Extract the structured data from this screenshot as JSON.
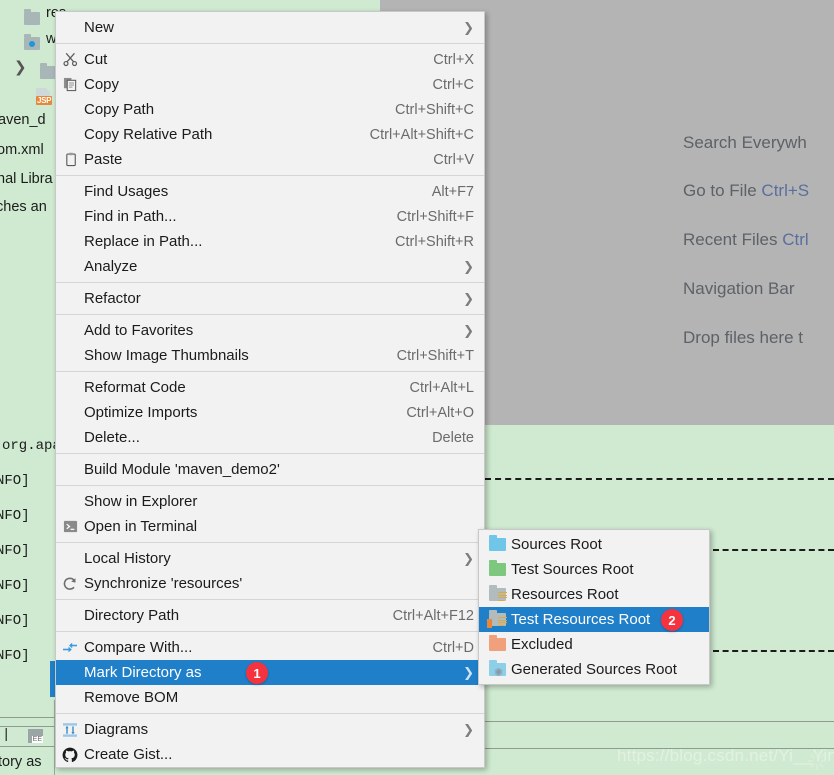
{
  "app": {
    "watermark": "https://blog.csdn.net/Yi__Ying"
  },
  "colors": {
    "menu_bg": "#f2f2f2",
    "selection_blue": "#1f7fc9",
    "badge_red": "#f5333f",
    "editor_gray": "#b4b4b4",
    "tree_green": "#cfead0"
  },
  "project_tree": {
    "items": [
      {
        "label": "res",
        "icon": "folder-icon"
      },
      {
        "label": "we",
        "icon": "folder-web-icon"
      },
      {
        "label": "",
        "icon": "folder-icon"
      },
      {
        "label": "JSP",
        "icon": "jsp-file-icon"
      },
      {
        "label": "aven_d",
        "icon": "none"
      },
      {
        "label": "om.xml",
        "icon": "none"
      },
      {
        "label": "nal Libra",
        "icon": "none"
      },
      {
        "label": "ches an",
        "icon": "none"
      }
    ]
  },
  "console": {
    "lines": [
      "org.apa",
      "NFO]",
      "NFO]",
      "NFO]",
      "NFO]",
      "NFO]",
      "NFO]"
    ]
  },
  "status_bar": {
    "label": "tory as"
  },
  "editor_hints": [
    {
      "text": "Search Everywh",
      "shortcut": ""
    },
    {
      "text": "Go to File ",
      "shortcut": "Ctrl+S"
    },
    {
      "text": "Recent Files ",
      "shortcut": "Ctrl"
    },
    {
      "text": "Navigation Bar ",
      "shortcut": ""
    },
    {
      "text": "Drop files here t",
      "shortcut": ""
    }
  ],
  "context_menu": {
    "groups": [
      {
        "items": [
          {
            "label": "New",
            "shortcut": "",
            "icon": "none",
            "submenu": true,
            "mnemonic": ""
          }
        ]
      },
      {
        "items": [
          {
            "label": "Cut",
            "shortcut": "Ctrl+X",
            "icon": "scissors-icon",
            "submenu": false,
            "mnemonic": "t"
          },
          {
            "label": "Copy",
            "shortcut": "Ctrl+C",
            "icon": "copy-icon",
            "submenu": false,
            "mnemonic": "C"
          },
          {
            "label": "Copy Path",
            "shortcut": "Ctrl+Shift+C",
            "icon": "none",
            "submenu": false,
            "mnemonic": "o"
          },
          {
            "label": "Copy Relative Path",
            "shortcut": "Ctrl+Alt+Shift+C",
            "icon": "none",
            "submenu": false,
            "mnemonic": "y"
          },
          {
            "label": "Paste",
            "shortcut": "Ctrl+V",
            "icon": "clipboard-icon",
            "submenu": false,
            "mnemonic": "P"
          }
        ]
      },
      {
        "items": [
          {
            "label": "Find Usages",
            "shortcut": "Alt+F7",
            "icon": "none",
            "submenu": false,
            "mnemonic": "U"
          },
          {
            "label": "Find in Path...",
            "shortcut": "Ctrl+Shift+F",
            "icon": "none",
            "submenu": false,
            "mnemonic": "P"
          },
          {
            "label": "Replace in Path...",
            "shortcut": "Ctrl+Shift+R",
            "icon": "none",
            "submenu": false,
            "mnemonic": "a"
          },
          {
            "label": "Analyze",
            "shortcut": "",
            "icon": "none",
            "submenu": true,
            "mnemonic": "z"
          }
        ]
      },
      {
        "items": [
          {
            "label": "Refactor",
            "shortcut": "",
            "icon": "none",
            "submenu": true,
            "mnemonic": "R"
          }
        ]
      },
      {
        "items": [
          {
            "label": "Add to Favorites",
            "shortcut": "",
            "icon": "none",
            "submenu": true,
            "mnemonic": "F"
          },
          {
            "label": "Show Image Thumbnails",
            "shortcut": "Ctrl+Shift+T",
            "icon": "none",
            "submenu": false,
            "mnemonic": ""
          }
        ]
      },
      {
        "items": [
          {
            "label": "Reformat Code",
            "shortcut": "Ctrl+Alt+L",
            "icon": "none",
            "submenu": false,
            "mnemonic": "R"
          },
          {
            "label": "Optimize Imports",
            "shortcut": "Ctrl+Alt+O",
            "icon": "none",
            "submenu": false,
            "mnemonic": "z"
          },
          {
            "label": "Delete...",
            "shortcut": "Delete",
            "icon": "none",
            "submenu": false,
            "mnemonic": "D"
          }
        ]
      },
      {
        "items": [
          {
            "label": "Build Module 'maven_demo2'",
            "shortcut": "",
            "icon": "none",
            "submenu": false,
            "mnemonic": "M"
          }
        ]
      },
      {
        "items": [
          {
            "label": "Show in Explorer",
            "shortcut": "",
            "icon": "none",
            "submenu": false,
            "mnemonic": ""
          },
          {
            "label": "Open in Terminal",
            "shortcut": "",
            "icon": "terminal-icon",
            "submenu": false,
            "mnemonic": "O"
          }
        ]
      },
      {
        "items": [
          {
            "label": "Local History",
            "shortcut": "",
            "icon": "none",
            "submenu": true,
            "mnemonic": "H"
          },
          {
            "label": "Synchronize 'resources'",
            "shortcut": "",
            "icon": "refresh-icon",
            "submenu": false,
            "mnemonic": ""
          }
        ]
      },
      {
        "items": [
          {
            "label": "Directory Path",
            "shortcut": "Ctrl+Alt+F12",
            "icon": "none",
            "submenu": false,
            "mnemonic": "P"
          }
        ]
      },
      {
        "items": [
          {
            "label": "Compare With...",
            "shortcut": "Ctrl+D",
            "icon": "compare-icon",
            "submenu": false,
            "mnemonic": ""
          },
          {
            "label": "Mark Directory as",
            "shortcut": "",
            "icon": "none",
            "submenu": true,
            "selected": true,
            "badge": "1",
            "mnemonic": ""
          },
          {
            "label": "Remove BOM",
            "shortcut": "",
            "icon": "none",
            "submenu": false,
            "mnemonic": ""
          }
        ]
      },
      {
        "items": [
          {
            "label": "Diagrams",
            "shortcut": "",
            "icon": "diagram-icon",
            "submenu": true,
            "mnemonic": ""
          },
          {
            "label": "Create Gist...",
            "shortcut": "",
            "icon": "github-icon",
            "submenu": false,
            "mnemonic": ""
          }
        ]
      }
    ]
  },
  "submenu": {
    "title": "Mark Directory as",
    "badge": "2",
    "items": [
      {
        "label": "Sources Root",
        "icon": "folder-blue-icon",
        "color": "#6fc6e8",
        "selected": false
      },
      {
        "label": "Test Sources Root",
        "icon": "folder-green-icon",
        "color": "#7ec77e",
        "selected": false
      },
      {
        "label": "Resources Root",
        "icon": "folder-gray-lines-icon",
        "color": "#b3bcbc",
        "selected": false
      },
      {
        "label": "Test Resources Root",
        "icon": "folder-gray-green-lines-icon",
        "color": "#b3bcbc",
        "selected": true
      },
      {
        "label": "Excluded",
        "icon": "folder-orange-icon",
        "color": "#f0a07a",
        "selected": false
      },
      {
        "label": "Generated Sources Root",
        "icon": "folder-blue-gear-icon",
        "color": "#8ecfe8",
        "selected": false
      }
    ]
  }
}
